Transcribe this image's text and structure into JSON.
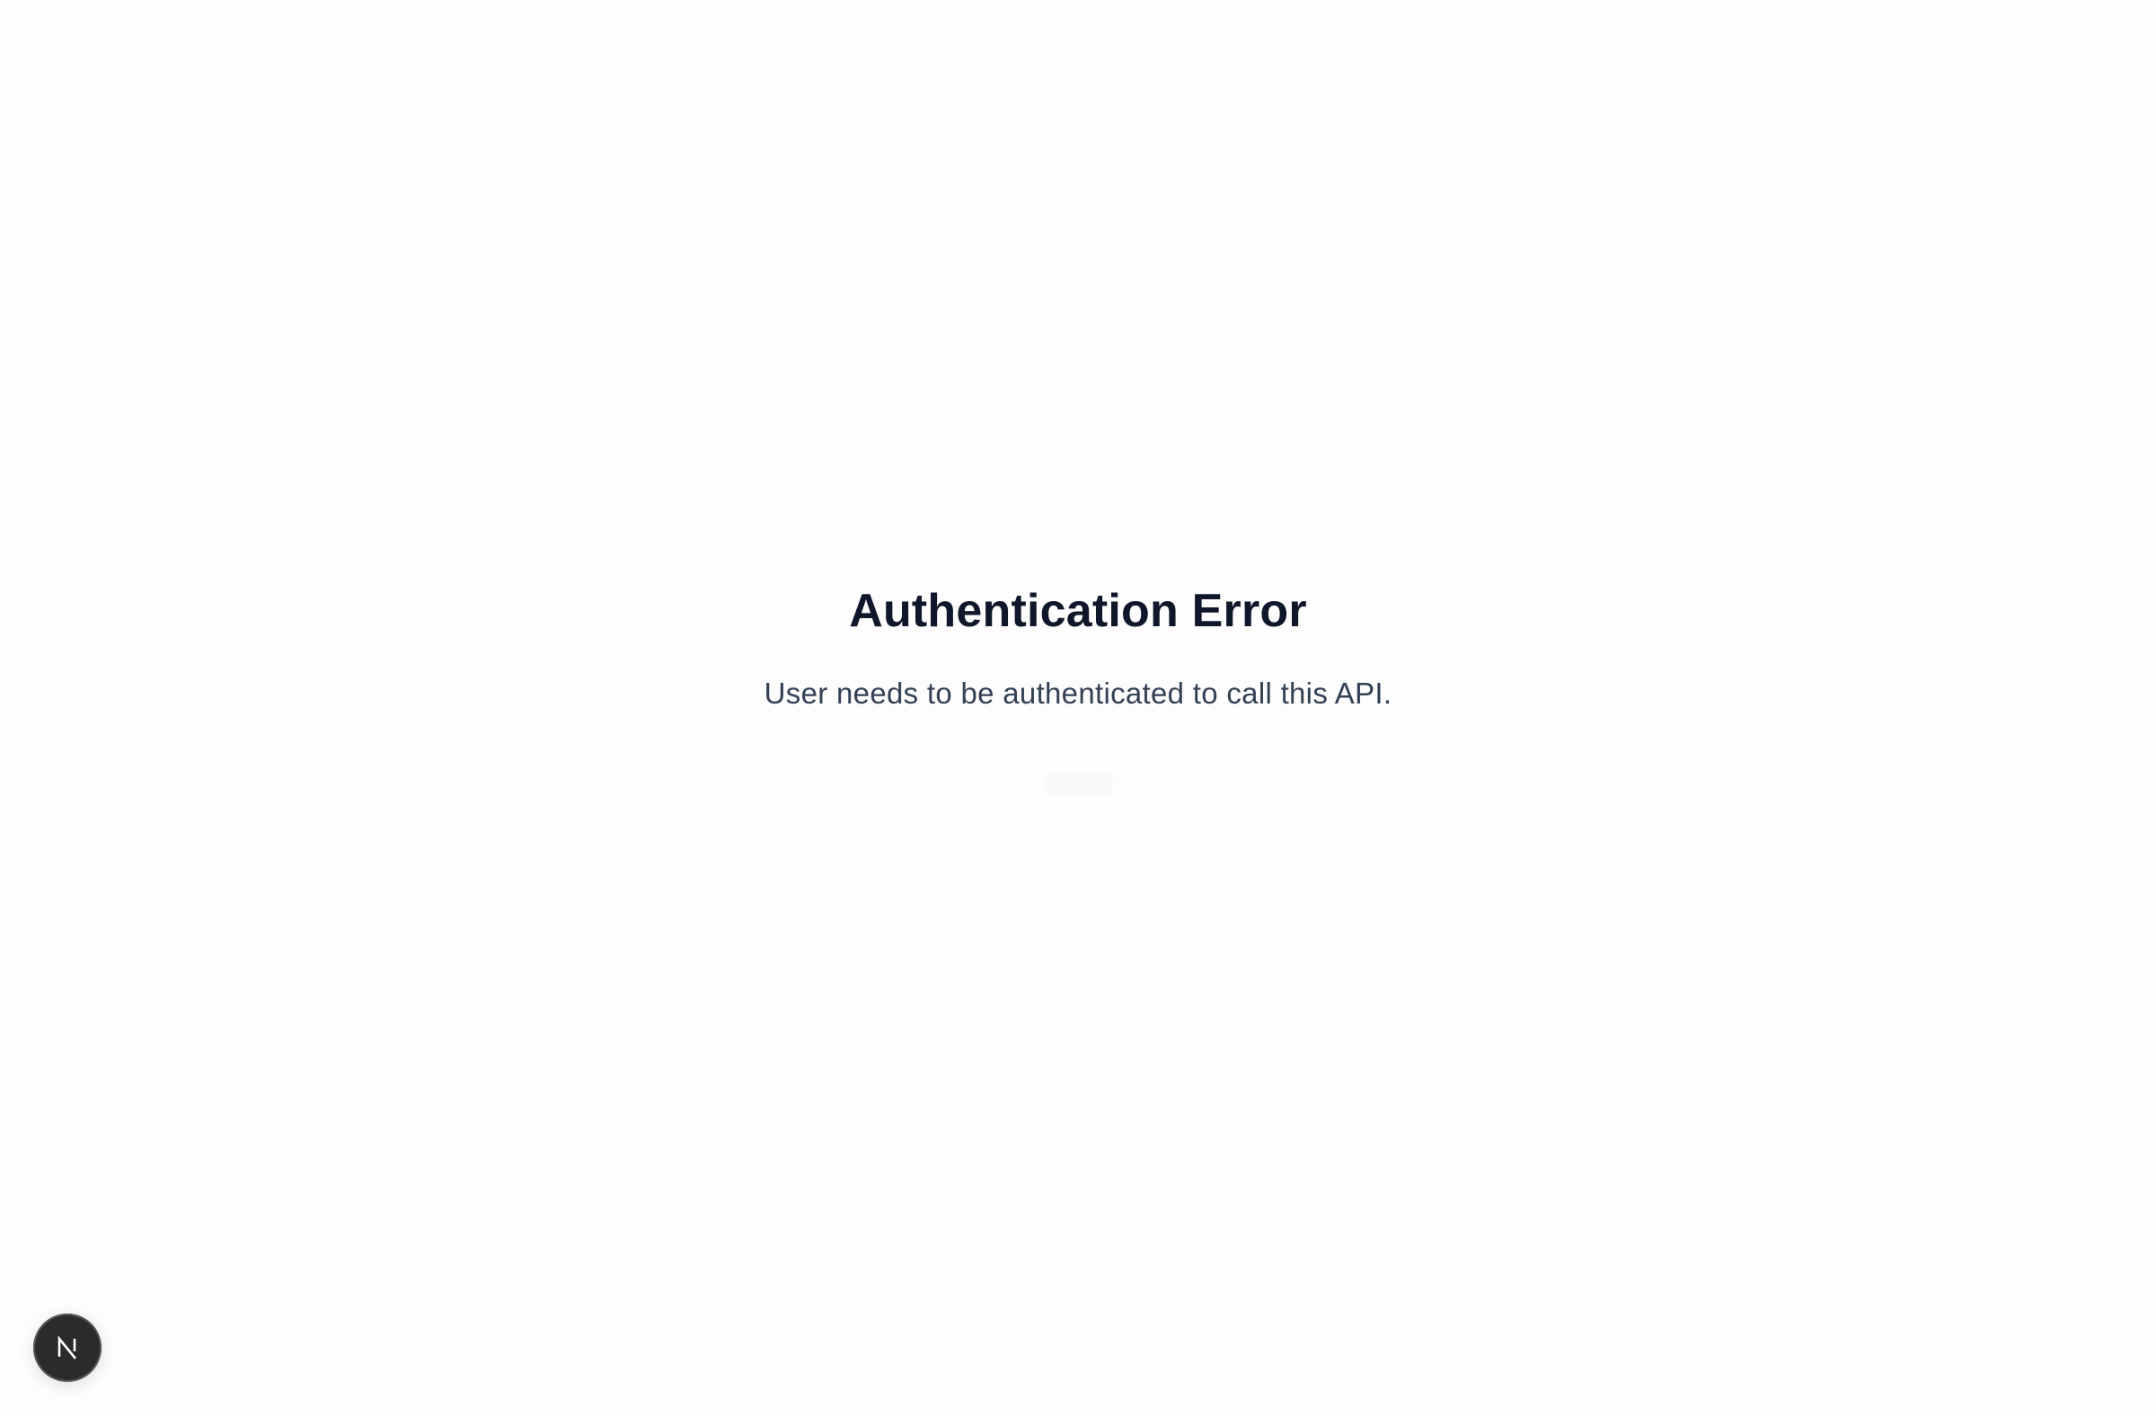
{
  "error": {
    "title": "Authentication Error",
    "message": "User needs to be authenticated to call this API."
  },
  "dev_badge": {
    "icon": "nextjs-logo-icon",
    "letter": "N"
  },
  "colors": {
    "background": "#fdfdfd",
    "title": "#0f172a",
    "message": "#334155",
    "badge": "#2b2b2b"
  }
}
